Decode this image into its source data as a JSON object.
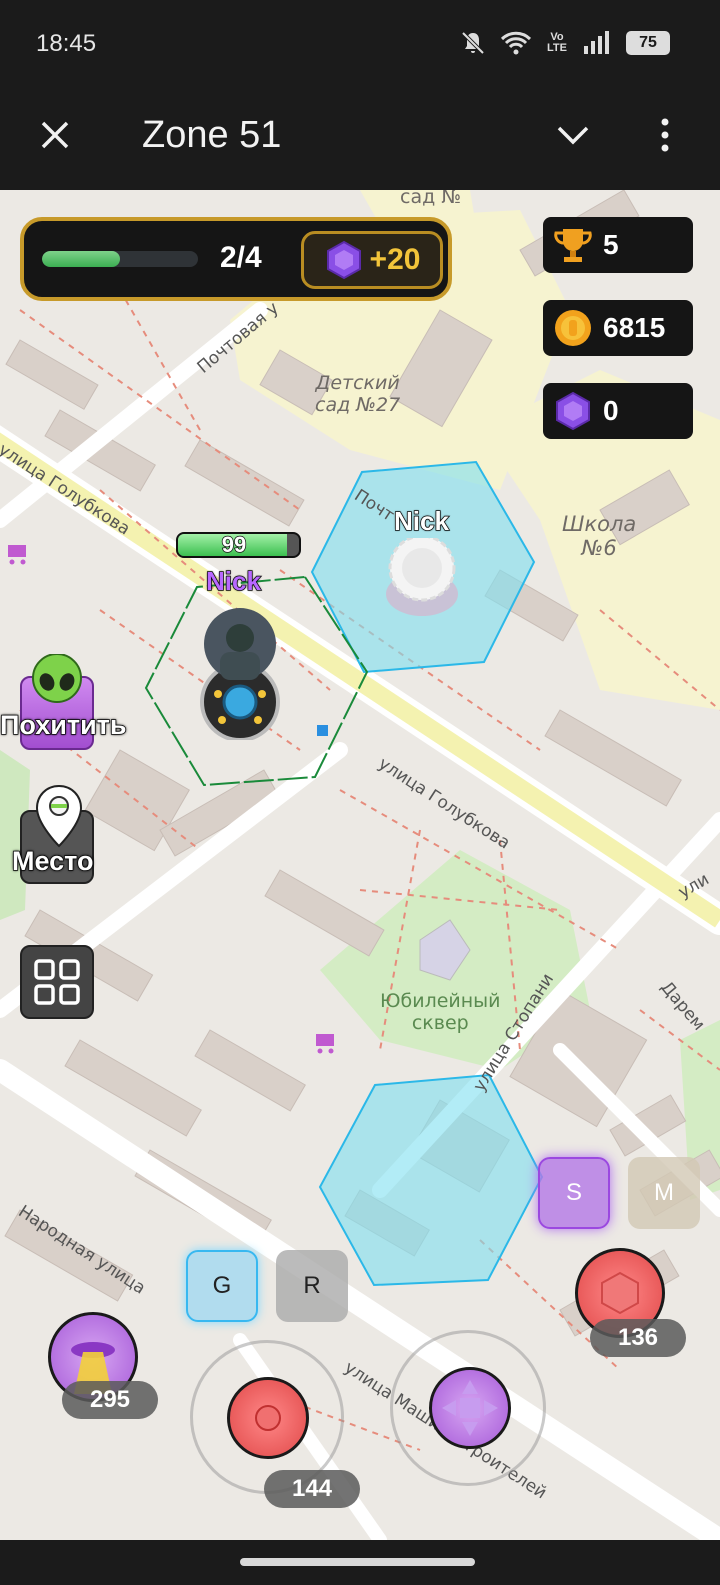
{
  "status_bar": {
    "time": "18:45",
    "battery": "75",
    "volte": "Vo LTE"
  },
  "header": {
    "title": "Zone 51"
  },
  "hud": {
    "progress": {
      "text": "2/4",
      "fill": 0.5
    },
    "gem_reward": "+20",
    "trophies": "5",
    "coins": "6815",
    "gems": "0"
  },
  "player": {
    "name": "Nick",
    "hp": "99",
    "hp_fill": 0.9
  },
  "enemy_base": {
    "name": "Nick"
  },
  "side_buttons": {
    "abduct": "Похитить",
    "place": "Место"
  },
  "controls": {
    "g_label": "G",
    "r_label": "R",
    "s_label": "S",
    "m_label": "M",
    "ufo_count": "295",
    "fire_count": "144",
    "hex_count": "136"
  },
  "map_labels": {
    "kindergarten_top": "сад №",
    "kindergarten": "Детский\nсад №27",
    "school": "Школа\n№6",
    "park": "Юбилейный\nсквер",
    "street_golubkova_1": "улица Голубкова",
    "street_golubkova_2": "улица Голубкова",
    "street_pochtovaya": "Почтовая у",
    "street_pochtovaya_2": "Почт",
    "street_stopani": "улица Стопани",
    "street_narodnaya": "Народная улица",
    "street_mashinostroiteley": "улица Машиностроителей",
    "street_dare": "Дарем",
    "street_ul": "ули"
  },
  "colors": {
    "gold": "#c79a2a",
    "hex_fill": "#7fe0f0",
    "purple": "#9b59d6",
    "red_button": "#e85a5a"
  }
}
